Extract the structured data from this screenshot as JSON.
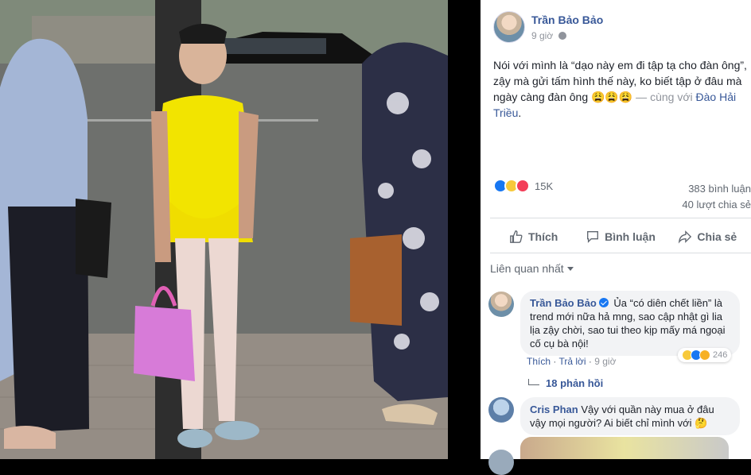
{
  "post": {
    "author": "Trần Bảo Bảo",
    "time": "9 giờ",
    "text_main": "Nói với mình là “dạo này em đi tập tạ cho đàn ông”, zậy mà gửi tấm hình thế này, ko biết tập ở đâu mà ngày càng đàn ông 😩😩😩",
    "with_prefix": " — cùng với ",
    "with_name": "Đào Hải Triều",
    "with_suffix": ".",
    "reaction_count": "15K",
    "comments_count": "383 bình luận",
    "shares_count": "40 lượt chia sẻ"
  },
  "actions": {
    "like": "Thích",
    "comment": "Bình luận",
    "share": "Chia sẻ"
  },
  "sort_label": "Liên quan nhất",
  "comments": [
    {
      "author": "Trần Bảo Bảo",
      "text": "Ủa “có diên chết liền” là trend mới nữa hả mng, sao cập nhật gì lia lịa zậy chời, sao tui theo kịp mấy má ngoại cố cụ bà nội!",
      "like_label": "Thích",
      "reply_label": "Trả lời",
      "time": "9 giờ",
      "reactions": "246",
      "replies_label": "18 phản hồi"
    },
    {
      "author": "Cris Phan",
      "text": "Vậy với quần này mua ở đâu vậy mọi người? Ai biết chỉ mình với 🤔"
    }
  ],
  "colors": {
    "link": "#385898",
    "like_blue": "#1877f2",
    "love_red": "#f33e58",
    "haha_yellow": "#f7c93b"
  }
}
